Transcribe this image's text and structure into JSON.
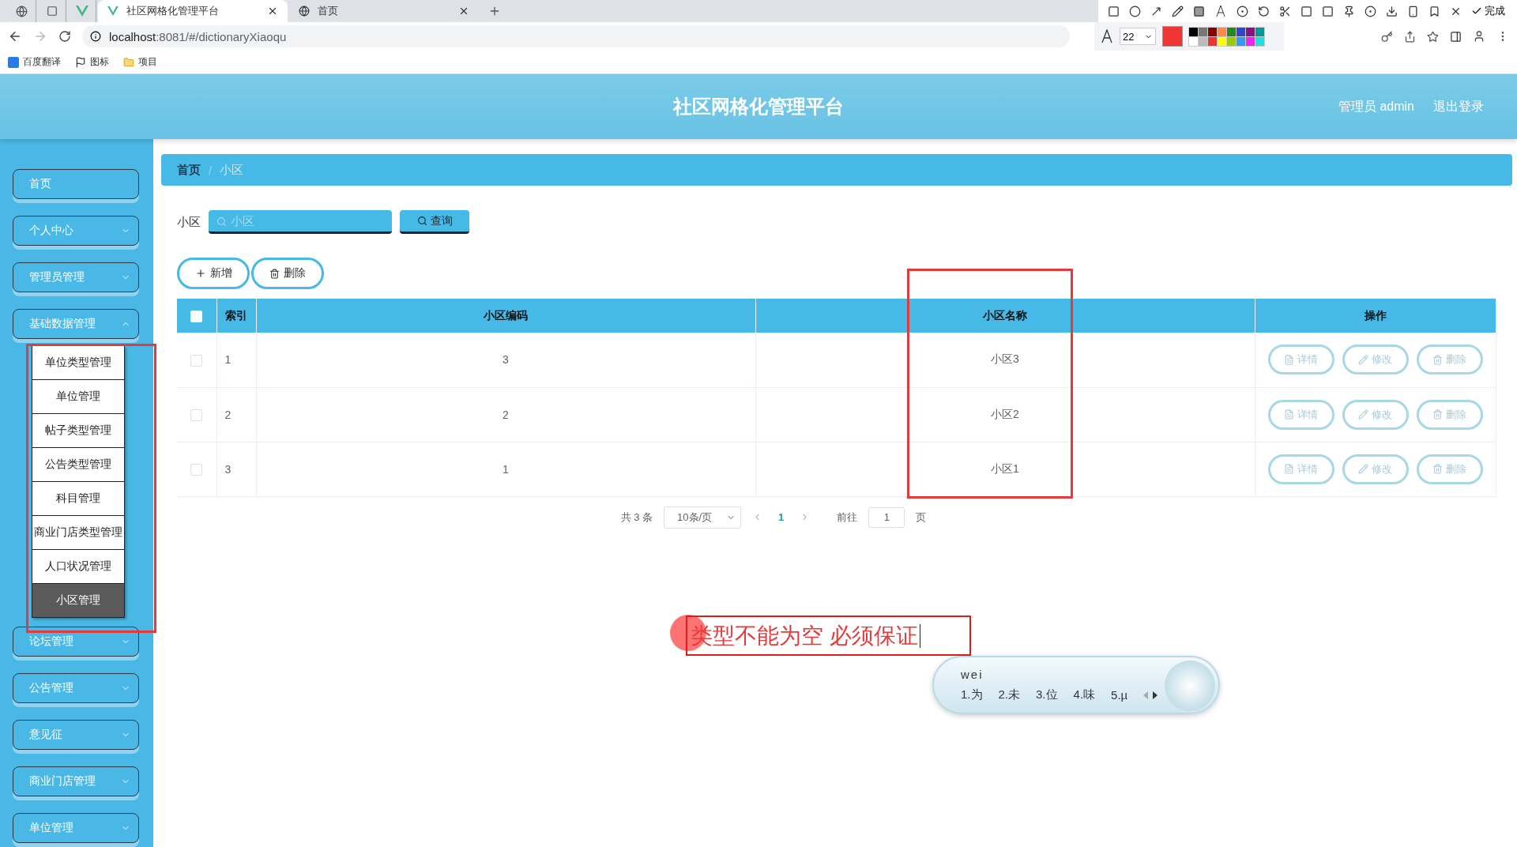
{
  "browser": {
    "tabs": [
      {
        "title": "社区网格化管理平台",
        "selected": true
      },
      {
        "title": "首页",
        "selected": false
      }
    ],
    "address": {
      "host": "localhost",
      "rest": ":8081/#/dictionaryXiaoqu"
    },
    "bookmarks": [
      "百度翻译",
      "图标",
      "项目"
    ]
  },
  "capture_toolbar": {
    "done_label": "完成",
    "font_size": "22"
  },
  "header": {
    "title": "社区网格化管理平台",
    "user": "管理员 admin",
    "logout": "退出登录"
  },
  "sidebar": {
    "items": [
      {
        "label": "首页",
        "kind": "single"
      },
      {
        "label": "个人中心",
        "kind": "group",
        "expanded": false
      },
      {
        "label": "管理员管理",
        "kind": "group",
        "expanded": false
      },
      {
        "label": "基础数据管理",
        "kind": "group",
        "expanded": true,
        "children": [
          {
            "label": "单位类型管理",
            "selected": false
          },
          {
            "label": "单位管理",
            "selected": false
          },
          {
            "label": "帖子类型管理",
            "selected": false
          },
          {
            "label": "公告类型管理",
            "selected": false
          },
          {
            "label": "科目管理",
            "selected": false
          },
          {
            "label": "商业门店类型管理",
            "selected": false
          },
          {
            "label": "人口状况管理",
            "selected": false
          },
          {
            "label": "小区管理",
            "selected": true
          }
        ]
      },
      {
        "label": "论坛管理",
        "kind": "group",
        "expanded": false
      },
      {
        "label": "公告管理",
        "kind": "group",
        "expanded": false
      },
      {
        "label": "意见征",
        "kind": "group",
        "expanded": false
      },
      {
        "label": "商业门店管理",
        "kind": "group",
        "expanded": false
      },
      {
        "label": "单位管理",
        "kind": "group",
        "expanded": false
      }
    ]
  },
  "breadcrumb": [
    "首页",
    "/",
    "小区"
  ],
  "search": {
    "label": "小区",
    "placeholder": "小区",
    "button": "查询"
  },
  "actions": [
    {
      "label": "新增",
      "kind": "add"
    },
    {
      "label": "删除",
      "kind": "delete"
    }
  ],
  "table": {
    "all_checked": false,
    "columns": [
      "索引",
      "小区编码",
      "小区名称",
      "操作"
    ],
    "rows": [
      {
        "checked": false,
        "cells": [
          "1",
          "3",
          "小区3"
        ],
        "actions": [
          "详情",
          "修改",
          "删除"
        ]
      },
      {
        "checked": false,
        "cells": [
          "2",
          "2",
          "小区2"
        ],
        "actions": [
          "详情",
          "修改",
          "删除"
        ]
      },
      {
        "checked": false,
        "cells": [
          "3",
          "1",
          "小区1"
        ],
        "actions": [
          "详情",
          "修改",
          "删除"
        ]
      }
    ]
  },
  "pagination": {
    "total": "共 3 条",
    "page_size": "10条/页",
    "pages": [
      {
        "label": "1",
        "selected": true
      }
    ],
    "goto_label": "前往",
    "goto_value": "1",
    "goto_suffix": "页"
  },
  "annotation": {
    "text": "类型不能为空 必须保证"
  },
  "ime": {
    "input": "wei",
    "candidates": [
      "1.为",
      "2.未",
      "3.位",
      "4.味",
      "5.µ"
    ]
  }
}
